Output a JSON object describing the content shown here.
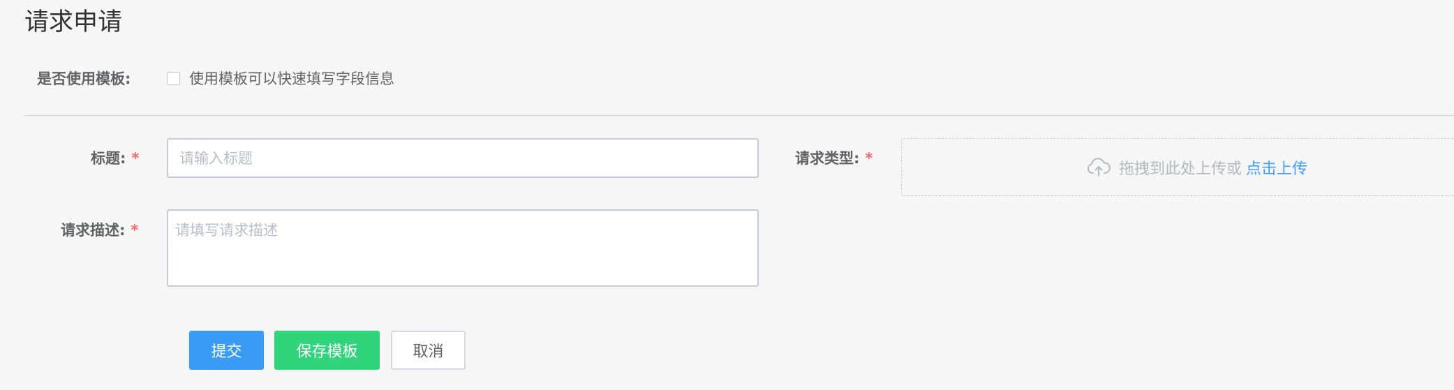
{
  "page": {
    "title": "请求申请"
  },
  "template": {
    "label": "是否使用模板:",
    "checkbox_text": "使用模板可以快速填写字段信息",
    "checked": false
  },
  "form": {
    "title": {
      "label": "标题:",
      "required_mark": "*",
      "placeholder": "请输入标题",
      "value": ""
    },
    "description": {
      "label": "请求描述:",
      "required_mark": "*",
      "placeholder": "请填写请求描述",
      "value": ""
    },
    "request_type": {
      "label": "请求类型:",
      "required_mark": "*",
      "upload_hint": "拖拽到此处上传或",
      "upload_link": "点击上传",
      "icon": "cloud-upload-icon"
    }
  },
  "actions": {
    "submit_label": "提交",
    "save_template_label": "保存模板",
    "cancel_label": "取消"
  },
  "colors": {
    "primary": "#3a9bf7",
    "success": "#2fd47b",
    "required": "#f56c6c",
    "link": "#409eff",
    "background": "#f6f6f6"
  }
}
